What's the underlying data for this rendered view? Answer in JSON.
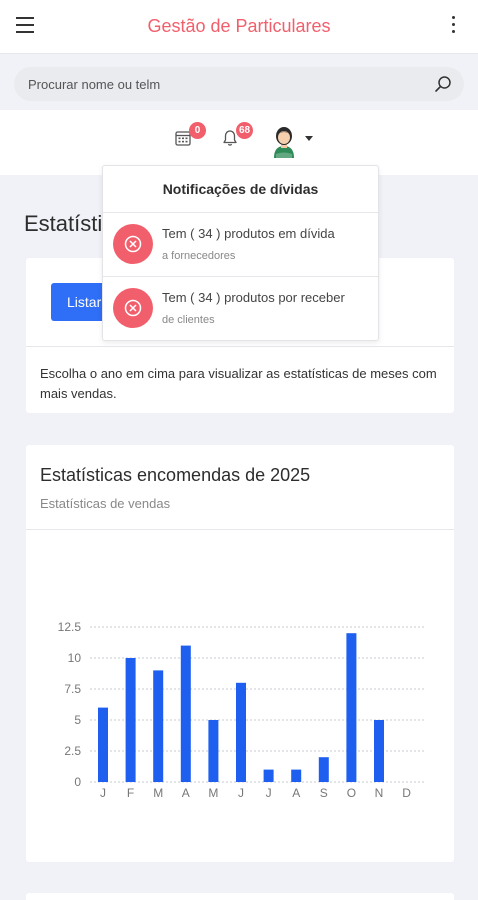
{
  "header": {
    "title": "Gestão de Particulares"
  },
  "search": {
    "placeholder": "Procurar nome ou telm"
  },
  "icons": {
    "calendar_badge": "0",
    "notifications_badge": "68"
  },
  "colors": {
    "accent": "#f25f6c",
    "primary": "#2f6ef6",
    "bar": "#1f5ff0"
  },
  "stats": {
    "title": "Estatísticas"
  },
  "stats_card": {
    "button_label": "Listar",
    "help_text": "Escolha o ano em cima para visualizar as estatísticas de meses com mais vendas."
  },
  "orders_card": {
    "title": "Estatísticas encomendas de 2025",
    "subtitle": "Estatísticas de vendas"
  },
  "notifications": {
    "title": "Notificações de dívidas",
    "items": [
      {
        "text": "Tem ( 34 ) produtos em dívida",
        "sub": "a fornecedores"
      },
      {
        "text": "Tem ( 34 ) produtos por receber",
        "sub": "de clientes"
      }
    ]
  },
  "chart_data": {
    "type": "bar",
    "categories": [
      "J",
      "F",
      "M",
      "A",
      "M",
      "J",
      "J",
      "A",
      "S",
      "O",
      "N",
      "D"
    ],
    "values": [
      6,
      10,
      9,
      11,
      5,
      8,
      1,
      1,
      2,
      12,
      5,
      0
    ],
    "yticks": [
      "0",
      "2.5",
      "5",
      "7.5",
      "10",
      "12.5"
    ],
    "ylim": [
      0,
      12.5
    ],
    "grid": true
  }
}
